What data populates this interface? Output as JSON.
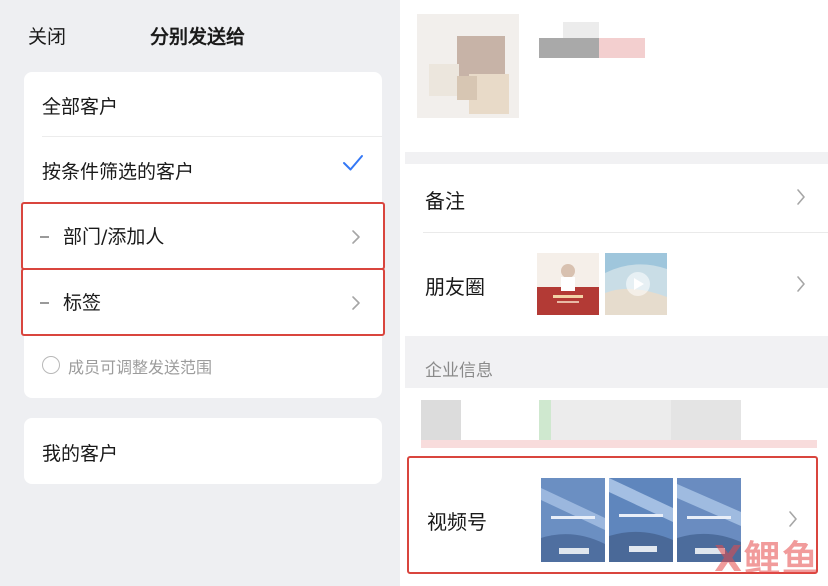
{
  "left": {
    "close_label": "关闭",
    "title": "分别发送给",
    "options": {
      "all_customers": "全部客户",
      "filtered_customers": "按条件筛选的客户"
    },
    "sub_filters": {
      "department": "部门/添加人",
      "tags": "标签"
    },
    "adjust_scope_label": "成员可调整发送范围",
    "my_customers": "我的客户",
    "accent_color": "#3478f6",
    "highlight_color": "#d9453e"
  },
  "right": {
    "remark_label": "备注",
    "moments_label": "朋友圈",
    "section_enterprise": "企业信息",
    "channels_label": "视频号"
  },
  "watermark": {
    "text": "X鲤鱼"
  }
}
